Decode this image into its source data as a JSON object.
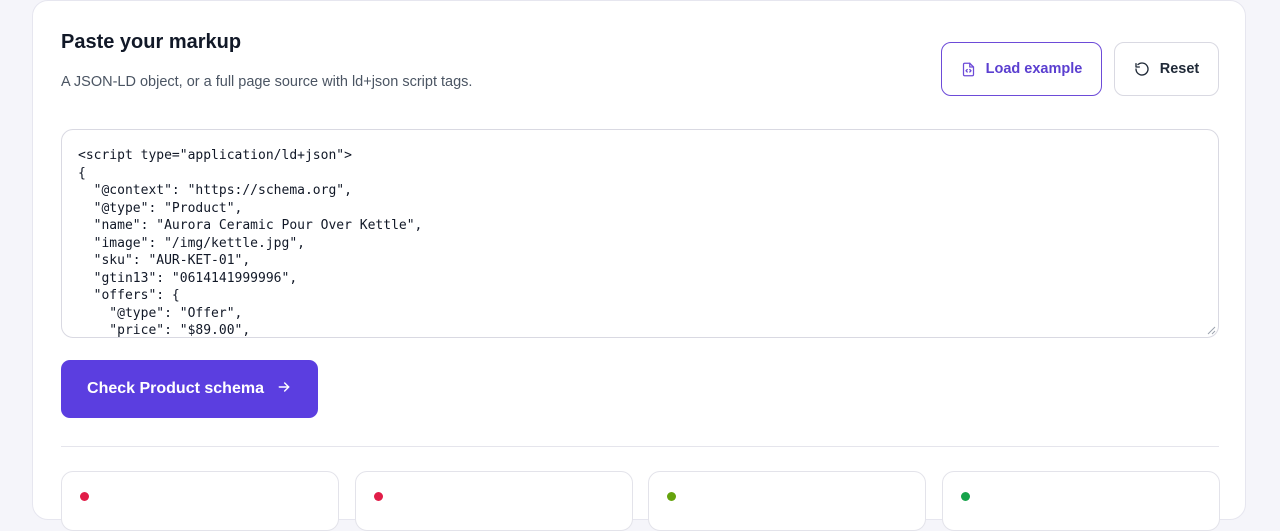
{
  "panel": {
    "title": "Paste your markup",
    "subtitle": "A JSON-LD object, or a full page source with ld+json script tags."
  },
  "toolbar": {
    "load_example_label": "Load example",
    "reset_label": "Reset"
  },
  "editor": {
    "code_lines": [
      "<script type=\"application/ld+json\">",
      "{",
      "  \"@context\": \"https://schema.org\",",
      "  \"@type\": \"Product\",",
      "  \"name\": \"Aurora Ceramic Pour Over Kettle\",",
      "  \"image\": \"/img/kettle.jpg\",",
      "  \"sku\": \"AUR-KET-01\",",
      "  \"gtin13\": \"0614141999996\",",
      "  \"offers\": {",
      "    \"@type\": \"Offer\",",
      "    \"price\": \"$89.00\","
    ]
  },
  "actions": {
    "check_label": "Check Product schema"
  },
  "stat_cards": [
    {
      "status_color": "#e11d48"
    },
    {
      "status_color": "#e11d48"
    },
    {
      "status_color": "#65a30d"
    },
    {
      "status_color": "#16a34a"
    }
  ],
  "colors": {
    "accent": "#5b3ee0",
    "accent_text": "#5b3fd0"
  },
  "icons": {
    "load_example": "code-file-icon",
    "reset": "rotate-ccw-icon",
    "check": "arrow-right-icon"
  }
}
